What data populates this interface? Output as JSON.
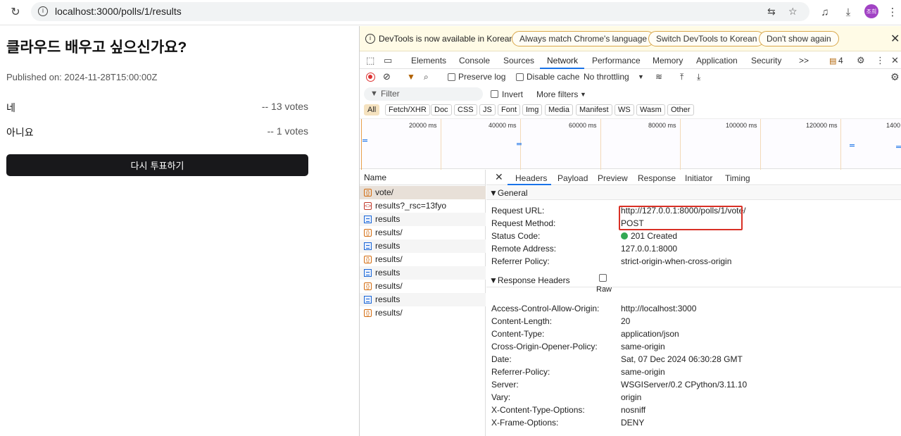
{
  "browser": {
    "url": "localhost:3000/polls/1/results",
    "avatar_text": "조희"
  },
  "page": {
    "title": "클라우드 배우고 싶으신가요?",
    "published": "Published on: 2024-11-28T15:00:00Z",
    "options": [
      {
        "label": "네",
        "votes": "-- 13 votes"
      },
      {
        "label": "아니요",
        "votes": "-- 1 votes"
      }
    ],
    "revote_label": "다시 투표하기"
  },
  "devtools": {
    "infobar": {
      "text": "DevTools is now available in Korean!",
      "btn_match": "Always match Chrome's language",
      "btn_switch": "Switch DevTools to Korean",
      "btn_dont": "Don't show again"
    },
    "tabs": [
      "Elements",
      "Console",
      "Sources",
      "Network",
      "Performance",
      "Memory",
      "Application",
      "Security"
    ],
    "tabs_more": ">>",
    "issues_count": "4",
    "toolbar": {
      "preserve_log": "Preserve log",
      "disable_cache": "Disable cache",
      "throttling": "No throttling"
    },
    "filter": {
      "placeholder": "Filter",
      "invert": "Invert",
      "more_filters": "More filters"
    },
    "types": [
      "All",
      "Fetch/XHR",
      "Doc",
      "CSS",
      "JS",
      "Font",
      "Img",
      "Media",
      "Manifest",
      "WS",
      "Wasm",
      "Other"
    ],
    "overview_labels": [
      "20000 ms",
      "40000 ms",
      "60000 ms",
      "80000 ms",
      "100000 ms",
      "120000 ms",
      "1400"
    ],
    "name_header": "Name",
    "requests": [
      {
        "name": "vote/",
        "icon": "fetch"
      },
      {
        "name": "results?_rsc=13fyo",
        "icon": "rsc"
      },
      {
        "name": "results",
        "icon": "doc"
      },
      {
        "name": "results/",
        "icon": "fetch"
      },
      {
        "name": "results",
        "icon": "doc"
      },
      {
        "name": "results/",
        "icon": "fetch"
      },
      {
        "name": "results",
        "icon": "doc"
      },
      {
        "name": "results/",
        "icon": "fetch"
      },
      {
        "name": "results",
        "icon": "doc"
      },
      {
        "name": "results/",
        "icon": "fetch"
      }
    ],
    "detail_tabs": [
      "Headers",
      "Payload",
      "Preview",
      "Response",
      "Initiator",
      "Timing"
    ],
    "general_title": "▼General",
    "general": [
      {
        "k": "Request URL:",
        "v": "http://127.0.0.1:8000/polls/1/vote/"
      },
      {
        "k": "Request Method:",
        "v": "POST"
      },
      {
        "k": "Status Code:",
        "v": "201 Created"
      },
      {
        "k": "Remote Address:",
        "v": "127.0.0.1:8000"
      },
      {
        "k": "Referrer Policy:",
        "v": "strict-origin-when-cross-origin"
      }
    ],
    "response_title": "▼Response Headers",
    "raw_label": "Raw",
    "response_headers": [
      {
        "k": "Access-Control-Allow-Origin:",
        "v": "http://localhost:3000"
      },
      {
        "k": "Content-Length:",
        "v": "20"
      },
      {
        "k": "Content-Type:",
        "v": "application/json"
      },
      {
        "k": "Cross-Origin-Opener-Policy:",
        "v": "same-origin"
      },
      {
        "k": "Date:",
        "v": "Sat, 07 Dec 2024 06:30:28 GMT"
      },
      {
        "k": "Referrer-Policy:",
        "v": "same-origin"
      },
      {
        "k": "Server:",
        "v": "WSGIServer/0.2 CPython/3.11.10"
      },
      {
        "k": "Vary:",
        "v": "origin"
      },
      {
        "k": "X-Content-Type-Options:",
        "v": "nosniff"
      },
      {
        "k": "X-Frame-Options:",
        "v": "DENY"
      }
    ]
  }
}
